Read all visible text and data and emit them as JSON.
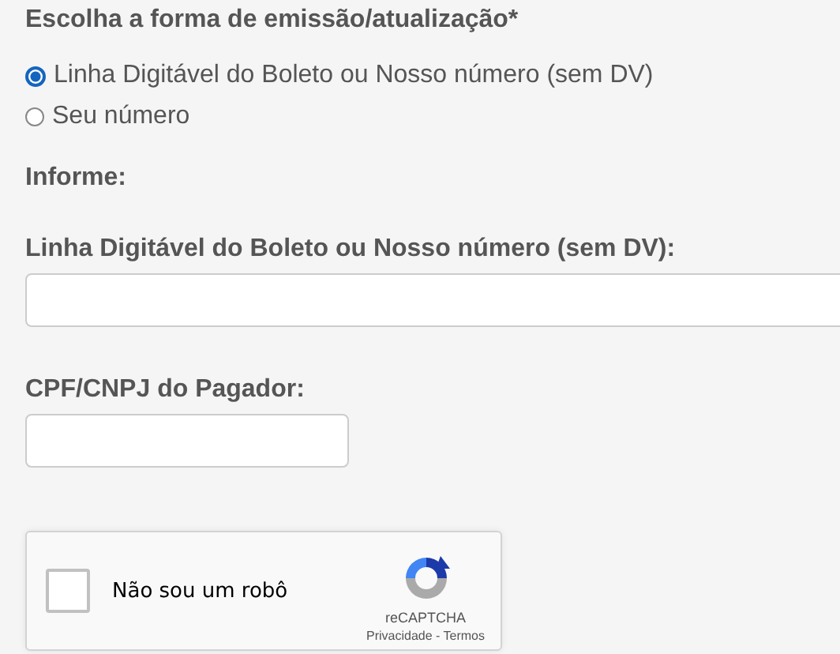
{
  "title": "Escolha a forma de emissão/atualização*",
  "options": [
    {
      "label": "Linha Digitável do Boleto ou Nosso número (sem DV)",
      "selected": true
    },
    {
      "label": "Seu número",
      "selected": false
    }
  ],
  "section_label": "Informe:",
  "fields": [
    {
      "label": "Linha Digitável do Boleto ou Nosso número (sem DV):",
      "kind": "wide"
    },
    {
      "label": "CPF/CNPJ do Pagador:",
      "kind": "short"
    }
  ],
  "captcha": {
    "label": "Não sou um robô",
    "checked": false,
    "brand": "reCAPTCHA",
    "links": "Privacidade - Termos"
  }
}
